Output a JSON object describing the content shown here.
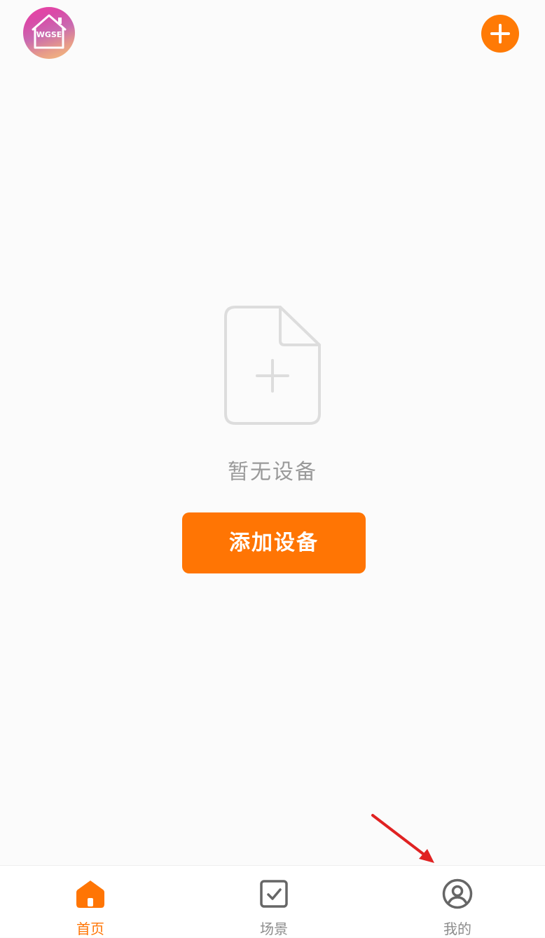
{
  "header": {
    "logo_text": "WGSE",
    "add_icon": "plus-icon"
  },
  "empty_state": {
    "icon": "add-file-icon",
    "message": "暂无设备",
    "button_label": "添加设备"
  },
  "bottom_nav": {
    "items": [
      {
        "label": "首页",
        "icon": "home-icon",
        "active": true
      },
      {
        "label": "场景",
        "icon": "checkbox-icon",
        "active": false
      },
      {
        "label": "我的",
        "icon": "user-icon",
        "active": false
      }
    ]
  },
  "colors": {
    "accent": "#ff7504",
    "inactive": "#8c8c8c",
    "background": "#fbfbfb",
    "annotation": "#e02222"
  }
}
